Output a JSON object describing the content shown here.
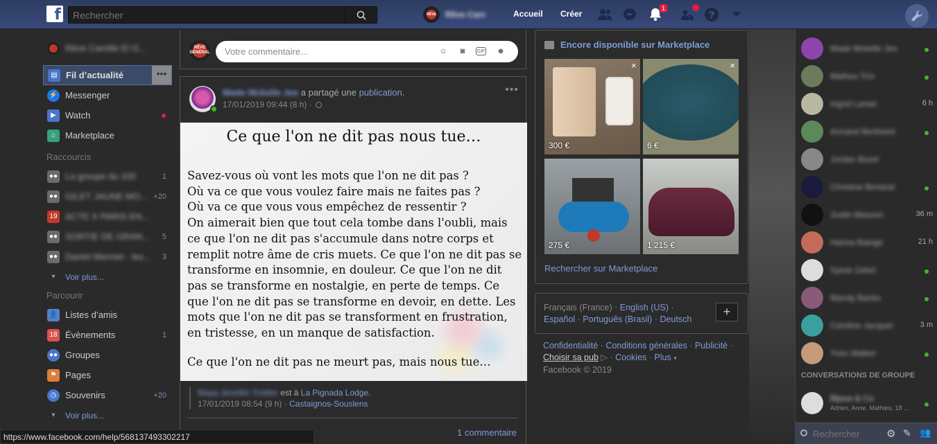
{
  "topbar": {
    "logo": "f",
    "search_placeholder": "Rechercher",
    "user_name": "Rêve Carc",
    "home_label": "Accueil",
    "create_label": "Créer",
    "notif_count": "1",
    "icons": [
      "friends-icon",
      "messenger-icon",
      "bell-icon",
      "quick-help-icon",
      "help-icon",
      "chevron-down-icon",
      "wrench-icon"
    ]
  },
  "leftnav": {
    "profile_name": "Rêve Camille El G...",
    "main": [
      {
        "label": "Fil d’actualité",
        "icon": "newsfeed-icon",
        "color": "#4a76c9"
      },
      {
        "label": "Messenger",
        "icon": "messenger-icon",
        "color": "#1877f2"
      },
      {
        "label": "Watch",
        "icon": "watch-icon",
        "color": "#4a76c9"
      },
      {
        "label": "Marketplace",
        "icon": "shop-icon",
        "color": "#37a07d"
      }
    ],
    "shortcuts_title": "Raccourcis",
    "shortcuts": [
      {
        "label": "La groupe du 100",
        "count": "1"
      },
      {
        "label": "GILET JAUNE MO...",
        "count": "+20"
      },
      {
        "label": "ACTE X PARIS EN...",
        "count": ""
      },
      {
        "label": "SORTIE DE GRAN...",
        "count": "5"
      },
      {
        "label": "Daniel Mermet - les...",
        "count": "3"
      }
    ],
    "see_more": "Voir plus...",
    "explore_title": "Parcourir",
    "explore": [
      {
        "label": "Listes d’amis",
        "count": "",
        "color": "#5b7dc2"
      },
      {
        "label": "Évènements",
        "count": "1",
        "color": "#d9534f"
      },
      {
        "label": "Groupes",
        "count": "",
        "color": "#4a76c9"
      },
      {
        "label": "Pages",
        "count": "",
        "color": "#e07b39"
      },
      {
        "label": "Souvenirs",
        "count": "+20",
        "color": "#4a76c9"
      }
    ],
    "see_more2": "Voir plus..."
  },
  "comment_box": {
    "placeholder": "Votre commentaire...",
    "avatar_text": "RÊVE GÉNÉRAL"
  },
  "post": {
    "author": "Made Mckelle Jee",
    "action": "a partagé une",
    "object": "publication",
    "period": ".",
    "time": "17/01/2019 09:44 (8 h) ·",
    "image_title": "Ce que l'on ne dit pas nous tue…",
    "image_body": "Savez-vous où vont les mots que l'on ne dit pas ?\nOù va ce que vous voulez faire mais ne faites pas ?\nOù va ce que vous vous empêchez de ressentir ?\nOn aimerait bien que tout cela tombe dans l'oubli, mais ce que l'on ne dit pas s'accumule dans notre corps et remplit notre âme de cris muets. Ce que l'on ne dit pas se transforme en insomnie, en douleur. Ce que l'on ne dit pas se transforme en nostalgie, en perte de temps. Ce que l'on ne dit pas se transforme en devoir, en dette. Les mots que l'on ne dit pas se transforment en frustration, en tristesse, en un manque de satisfaction.",
    "image_end": "Ce que l'on ne dit pas ne meurt pas, mais nous tue…",
    "shared_author": "Maya Jennifer Trottier",
    "shared_action": "est à",
    "shared_place": "La Pignada Lodge",
    "shared_time": "17/01/2019 08:54 (9 h) ·",
    "shared_location": "Castaignos-Souslens",
    "comments": "1 commentaire"
  },
  "marketplace": {
    "title": "Encore disponible sur Marketplace",
    "items": [
      {
        "price": "300 €",
        "desc": "iphone"
      },
      {
        "price": "6 €",
        "desc": "pool cover"
      },
      {
        "price": "275 €",
        "desc": "compressor"
      },
      {
        "price": "1 215 €",
        "desc": "car"
      }
    ],
    "search_link": "Rechercher sur Marketplace"
  },
  "languages": {
    "current": "Français (France)",
    "others": [
      "English (US)",
      "Español",
      "Português (Brasil)",
      "Deutsch"
    ],
    "add": "+"
  },
  "footer": {
    "links": [
      "Confidentialité",
      "Conditions générales",
      "Publicité",
      "Choisir sa pub",
      "Cookies",
      "Plus"
    ],
    "copyright": "Facebook © 2019"
  },
  "chat": {
    "contacts": [
      {
        "name": "Made Mckelle Jee",
        "status": "online",
        "time": "",
        "color": "#8e44ad"
      },
      {
        "name": "Mathou Troi",
        "status": "online",
        "time": "",
        "color": "#6d7b5a"
      },
      {
        "name": "Ingrid Lamet",
        "status": "",
        "time": "6 h",
        "color": "#b8b8a0"
      },
      {
        "name": "Armand Berthelot",
        "status": "online",
        "time": "",
        "color": "#5a8a5a"
      },
      {
        "name": "Jordan Bezel",
        "status": "",
        "time": "",
        "color": "#888"
      },
      {
        "name": "Christine Bertand",
        "status": "online",
        "time": "",
        "color": "#1a1a3a"
      },
      {
        "name": "Justin Masson",
        "status": "",
        "time": "36 m",
        "color": "#111"
      },
      {
        "name": "Hanna Balogé",
        "status": "",
        "time": "21 h",
        "color": "#c46a5a"
      },
      {
        "name": "Sylvie Zahel",
        "status": "online",
        "time": "",
        "color": "#ddd"
      },
      {
        "name": "Mandy Banks",
        "status": "online",
        "time": "",
        "color": "#8a5a7a"
      },
      {
        "name": "Caroline Jacquet",
        "status": "",
        "time": "3 m",
        "color": "#3aa0a0"
      },
      {
        "name": "Yves Walker",
        "status": "online",
        "time": "",
        "color": "#c49a7a"
      }
    ],
    "group_title": "CONVERSATIONS DE GROUPE",
    "group": {
      "name": "Bijoux & Co",
      "members": "Adrien, Anne, Mathieu, 18 ...",
      "status": "online"
    },
    "search_placeholder": "Rechercher"
  },
  "status_url": "https://www.facebook.com/help/568137493302217"
}
